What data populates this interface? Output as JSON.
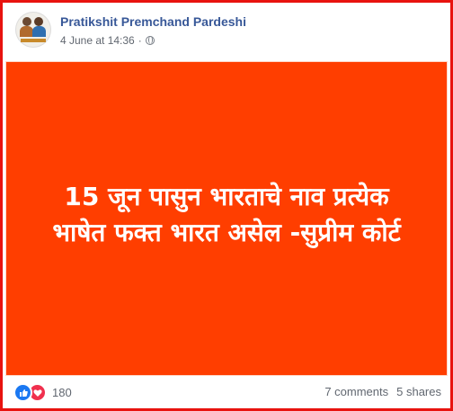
{
  "post": {
    "author": "Pratikshit Premchand Pardeshi",
    "timestamp": "4 June at 14:36",
    "privacy_icon": "globe-icon",
    "headline_line1": "15 जून पासुन भारताचे नाव प्रत्येक",
    "headline_line2": "भाषेत फक्त भारत असेल -सुप्रीम कोर्ट",
    "image_background": "#ff3e00"
  },
  "engagement": {
    "reaction_count": "180",
    "comments": "7 comments",
    "shares": "5 shares"
  },
  "colors": {
    "author_link": "#385898",
    "frame_border": "#e8130f",
    "like": "#1a78f2",
    "love": "#f0304e"
  }
}
